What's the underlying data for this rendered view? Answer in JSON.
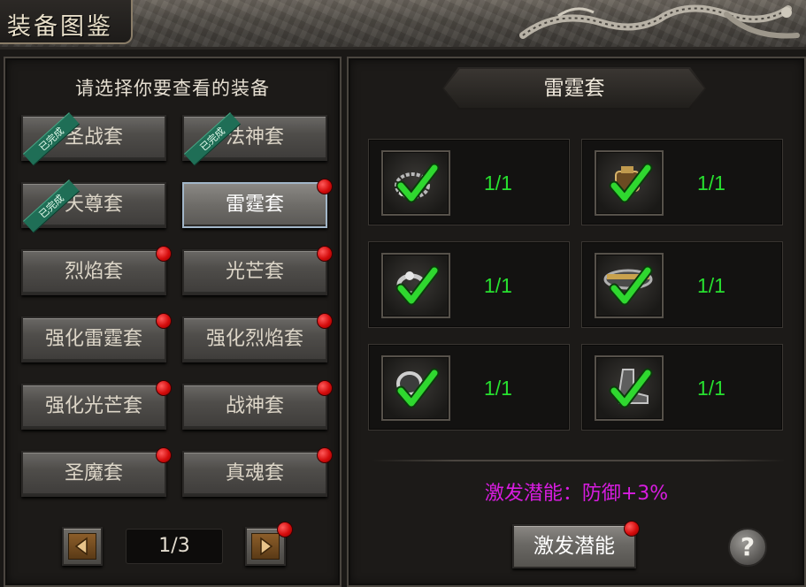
{
  "window": {
    "title": "装备图鉴"
  },
  "left": {
    "header": "请选择你要查看的装备",
    "sets": [
      {
        "label": "圣战套",
        "completed": true,
        "completed_label": "已完成",
        "alert": false
      },
      {
        "label": "法神套",
        "completed": true,
        "completed_label": "已完成",
        "alert": false
      },
      {
        "label": "天尊套",
        "completed": true,
        "completed_label": "已完成",
        "alert": false
      },
      {
        "label": "雷霆套",
        "completed": false,
        "alert": true,
        "selected": true
      },
      {
        "label": "烈焰套",
        "completed": false,
        "alert": true
      },
      {
        "label": "光芒套",
        "completed": false,
        "alert": true
      },
      {
        "label": "强化雷霆套",
        "completed": false,
        "alert": true
      },
      {
        "label": "强化烈焰套",
        "completed": false,
        "alert": true
      },
      {
        "label": "强化光芒套",
        "completed": false,
        "alert": true
      },
      {
        "label": "战神套",
        "completed": false,
        "alert": true
      },
      {
        "label": "圣魔套",
        "completed": false,
        "alert": true
      },
      {
        "label": "真魂套",
        "completed": false,
        "alert": true
      }
    ],
    "pager": {
      "page": "1/3",
      "next_alert": true
    }
  },
  "right": {
    "set_title": "雷霆套",
    "items": [
      {
        "icon": "necklace-icon",
        "count": "1/1",
        "collected": true
      },
      {
        "icon": "helmet-icon",
        "count": "1/1",
        "collected": true
      },
      {
        "icon": "ring-icon",
        "count": "1/1",
        "collected": true
      },
      {
        "icon": "belt-icon",
        "count": "1/1",
        "collected": true
      },
      {
        "icon": "bracelet-icon",
        "count": "1/1",
        "collected": true
      },
      {
        "icon": "boots-icon",
        "count": "1/1",
        "collected": true
      }
    ],
    "bonus_text": "激发潜能：防御+3%",
    "activate_label": "激发潜能",
    "help_label": "?"
  },
  "colors": {
    "count_green": "#27e02f",
    "bonus_magenta": "#d81ce0",
    "alert_red": "#d40c0c",
    "completed_ribbon": "#1f6e56"
  }
}
